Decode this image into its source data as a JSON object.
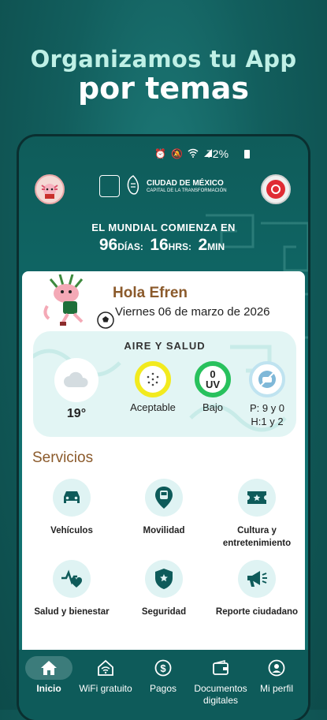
{
  "promo": {
    "line1": "Organizamos tu App",
    "line2": "por temas"
  },
  "status_bar": {
    "battery": "72%",
    "icons": [
      "alarm-icon",
      "mute-icon",
      "wifi-icon",
      "signal-icon",
      "battery-icon"
    ]
  },
  "header": {
    "brand_line1": "CIUDAD DE MÉXICO",
    "brand_line2": "CAPITAL DE LA TRANSFORMACIÓN"
  },
  "countdown": {
    "title": "EL MUNDIAL COMIENZA EN",
    "days": "96",
    "days_unit": "DÍAS:",
    "hours": "16",
    "hours_unit": "HRS:",
    "minutes": "2",
    "minutes_unit": "MIN"
  },
  "greeting": {
    "hello": "Hola Efren",
    "date": "Viernes 06 de marzo de 2026"
  },
  "air": {
    "title": "AIRE Y SALUD",
    "temperature": "19°",
    "quality": "Aceptable",
    "uv_value": "0",
    "uv_label": "UV",
    "uv_level": "Bajo",
    "traffic_line1": "P: 9 y 0",
    "traffic_line2": "H:1 y 2"
  },
  "services": {
    "title": "Servicios",
    "items": [
      {
        "label": "Vehículos",
        "icon": "car-icon"
      },
      {
        "label": "Movilidad",
        "icon": "bus-icon"
      },
      {
        "label": "Cultura y entretenimiento",
        "icon": "ticket-icon"
      },
      {
        "label": "Salud y bienestar",
        "icon": "heart-pulse-icon"
      },
      {
        "label": "Seguridad",
        "icon": "shield-icon"
      },
      {
        "label": "Reporte ciudadano",
        "icon": "megaphone-icon"
      }
    ]
  },
  "nav": {
    "items": [
      {
        "label": "Inicio",
        "icon": "home-icon",
        "active": true
      },
      {
        "label": "WiFi gratuito",
        "icon": "wifi-icon"
      },
      {
        "label": "Pagos",
        "icon": "dollar-icon"
      },
      {
        "label": "Documentos digitales",
        "icon": "wallet-icon"
      },
      {
        "label": "Mi perfil",
        "icon": "user-icon"
      }
    ]
  },
  "colors": {
    "teal_dark": "#0e5b5a",
    "brown": "#8b5a2b",
    "aqi_yellow": "#f2ea1e",
    "uv_green": "#28c15d",
    "record_red": "#e02b34"
  }
}
